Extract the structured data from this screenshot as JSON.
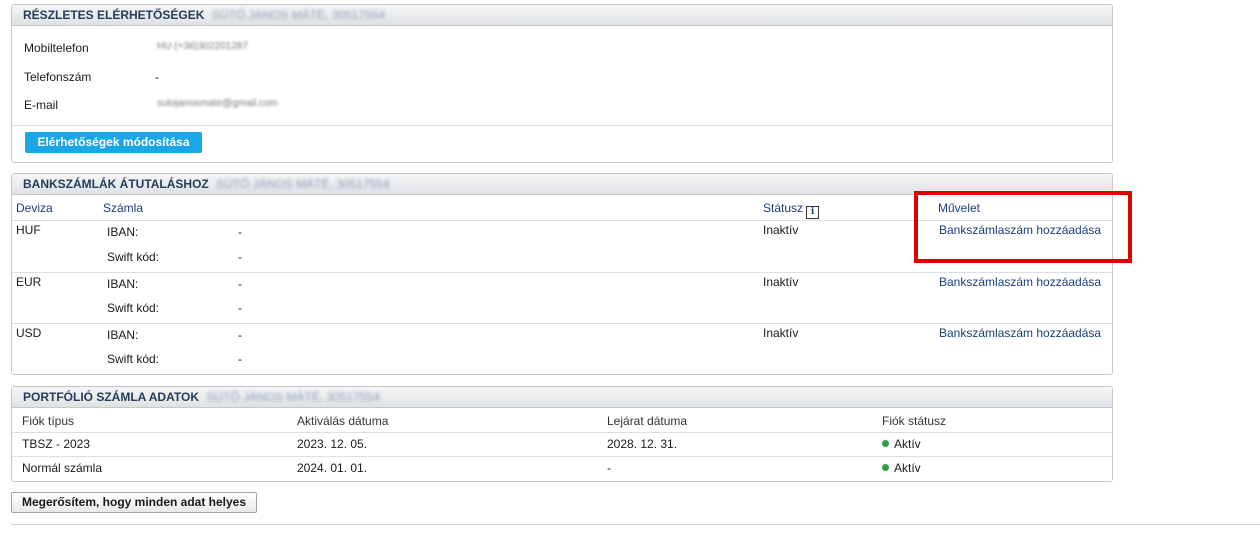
{
  "contacts": {
    "title": "RÉSZLETES ELÉRHETŐSÉGEK",
    "owner": "SÜTŐ JÁNOS MÁTÉ, 30517554",
    "rows": [
      {
        "label": "Mobiltelefon",
        "value": "HU (+36)302201287"
      },
      {
        "label": "Telefonszám",
        "value": "-"
      },
      {
        "label": "E-mail",
        "value": "sutojanosmate@gmail.com"
      }
    ],
    "edit_button": "Elérhetőségek módosítása"
  },
  "accounts": {
    "title": "BANKSZÁMLÁK ÁTUTALÁSHOZ",
    "owner": "SÜTŐ JÁNOS MÁTÉ, 30517554",
    "headers": {
      "currency": "Deviza",
      "account": "Számla",
      "status": "Státusz",
      "action": "Művelet"
    },
    "status_info_icon": "info-icon",
    "iban_label": "IBAN:",
    "swift_label": "Swift kód:",
    "rows": [
      {
        "currency": "HUF",
        "iban": "-",
        "swift": "-",
        "status": "Inaktív",
        "action": "Bankszámlaszám hozzáadása"
      },
      {
        "currency": "EUR",
        "iban": "-",
        "swift": "-",
        "status": "Inaktív",
        "action": "Bankszámlaszám hozzáadása"
      },
      {
        "currency": "USD",
        "iban": "-",
        "swift": "-",
        "status": "Inaktív",
        "action": "Bankszámlaszám hozzáadása"
      }
    ]
  },
  "portfolio": {
    "title": "PORTFÓLIÓ SZÁMLA ADATOK",
    "owner": "SÜTŐ JÁNOS MÁTÉ, 30517554",
    "headers": {
      "type": "Fiók típus",
      "activation": "Aktiválás dátuma",
      "expiry": "Lejárat dátuma",
      "status": "Fiók státusz"
    },
    "rows": [
      {
        "type": "TBSZ - 2023",
        "activation": "2023. 12. 05.",
        "expiry": "2028. 12. 31.",
        "status": "Aktív"
      },
      {
        "type": "Normál számla",
        "activation": "2024. 01. 01.",
        "expiry": "-",
        "status": "Aktív"
      }
    ]
  },
  "confirm_button": "Megerősítem, hogy minden adat helyes",
  "colors": {
    "accent": "#1aa7e8",
    "highlight": "#e10000",
    "status_active": "#2ea043",
    "link": "#1a3e7a"
  }
}
